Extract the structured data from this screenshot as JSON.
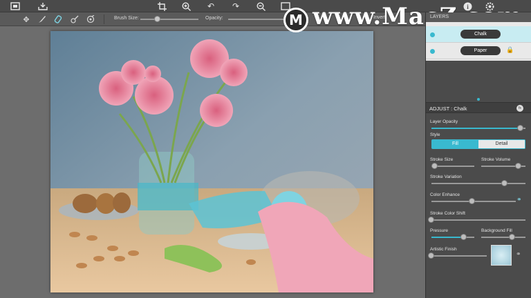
{
  "toolbar": {
    "icons": [
      "frame-icon",
      "import-icon",
      "crop-icon",
      "zoom-in-icon",
      "undo-icon",
      "redo-icon",
      "zoom-out-icon",
      "export-icon",
      "info-icon",
      "settings-icon"
    ]
  },
  "brushbar": {
    "tools": [
      "move-icon",
      "brush-icon",
      "eraser-icon",
      "smudge-icon",
      "target-icon"
    ],
    "brush_size_label": "Brush Size:",
    "opacity_label": "Opacity:",
    "invert_label": "Invert",
    "brush_size_value": 0.3,
    "opacity_value": 0.9
  },
  "watermark": {
    "logo_letter": "M",
    "text": "www.MacZ.com"
  },
  "layers": {
    "header": "LAYERS",
    "items": [
      {
        "name": "Chalk",
        "locked": false,
        "selected": true
      },
      {
        "name": "Paper",
        "locked": true,
        "selected": false
      }
    ]
  },
  "adjust": {
    "title": "ADJUST : Chalk",
    "layer_opacity_label": "Layer Opacity",
    "layer_opacity": 0.95,
    "style_label": "Style",
    "style_fill": "Fill",
    "style_detail": "Detail",
    "stroke_size_label": "Stroke Size",
    "stroke_size": 0.08,
    "stroke_volume_label": "Stroke Volume",
    "stroke_volume": 0.85,
    "stroke_variation_label": "Stroke Variation",
    "stroke_variation": 0.78,
    "color_enhance_label": "Color Enhance",
    "color_enhance": 0.48,
    "stroke_color_shift_label": "Stroke Color Shift",
    "stroke_color_shift": 0.0,
    "pressure_label": "Pressure",
    "pressure": 0.75,
    "background_fill_label": "Background Fill",
    "background_fill": 0.7,
    "artistic_finish_label": "Artistic Finish",
    "artistic_finish": 0.0
  },
  "colors": {
    "accent": "#39b9cf",
    "panel": "#4b4b4b",
    "toolbar": "#4a4a4a"
  }
}
